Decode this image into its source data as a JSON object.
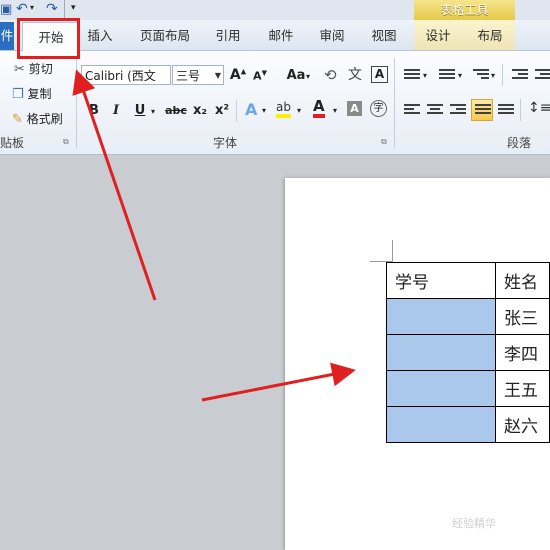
{
  "ribbon": {
    "contextual_group": "表格工具",
    "tabs": {
      "file": "件",
      "home": "开始",
      "insert": "插入",
      "page_layout": "页面布局",
      "references": "引用",
      "mailings": "邮件",
      "review": "审阅",
      "view": "视图",
      "design": "设计",
      "layout": "布局"
    },
    "clipboard": {
      "cut": "剪切",
      "copy": "复制",
      "format_painter": "格式刷",
      "group_label": "贴板"
    },
    "font": {
      "font_name": "Calibri (西文",
      "font_size": "三号",
      "grow": "A",
      "shrink": "A",
      "change_case": "Aa",
      "bold": "B",
      "italic": "I",
      "underline": "U",
      "strikethrough": "abc",
      "subscript": "x₂",
      "superscript": "x²",
      "group_label": "字体"
    },
    "paragraph": {
      "group_label": "段落"
    }
  },
  "document": {
    "table": {
      "header": [
        "学号",
        "姓名"
      ],
      "rows": [
        [
          "",
          "张三"
        ],
        [
          "",
          "李四"
        ],
        [
          "",
          "王五"
        ],
        [
          "",
          "赵六"
        ]
      ]
    }
  },
  "watermark": "经验精华",
  "colors": {
    "annotation_red": "#e02020",
    "selection_blue": "#a9c8ec",
    "file_tab_blue": "#2a6ec1",
    "contextual_gold": "#e6c94a"
  }
}
